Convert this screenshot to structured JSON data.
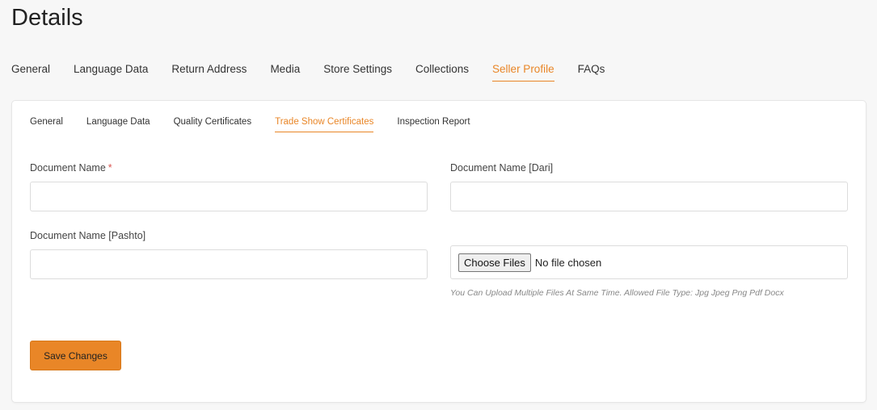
{
  "page": {
    "title": "Details"
  },
  "main_tabs": [
    {
      "label": "General",
      "active": false
    },
    {
      "label": "Language Data",
      "active": false
    },
    {
      "label": "Return Address",
      "active": false
    },
    {
      "label": "Media",
      "active": false
    },
    {
      "label": "Store Settings",
      "active": false
    },
    {
      "label": "Collections",
      "active": false
    },
    {
      "label": "Seller Profile",
      "active": true
    },
    {
      "label": "FAQs",
      "active": false
    }
  ],
  "sub_tabs": [
    {
      "label": "General",
      "active": false
    },
    {
      "label": "Language Data",
      "active": false
    },
    {
      "label": "Quality Certificates",
      "active": false
    },
    {
      "label": "Trade Show Certificates",
      "active": true
    },
    {
      "label": "Inspection Report",
      "active": false
    }
  ],
  "form": {
    "document_name": {
      "label": "Document Name",
      "required_mark": "*",
      "value": ""
    },
    "document_name_dari": {
      "label": "Document Name [Dari]",
      "value": ""
    },
    "document_name_pashto": {
      "label": "Document Name [Pashto]",
      "value": ""
    },
    "file_upload": {
      "button_label": "Choose Files",
      "status": "No file chosen",
      "hint": "You Can Upload Multiple Files At Same Time. Allowed File Type: Jpg Jpeg Png Pdf Docx"
    },
    "save_label": "Save Changes"
  },
  "colors": {
    "accent": "#e98627",
    "required": "#d9534f",
    "background": "#f7f7f7"
  }
}
